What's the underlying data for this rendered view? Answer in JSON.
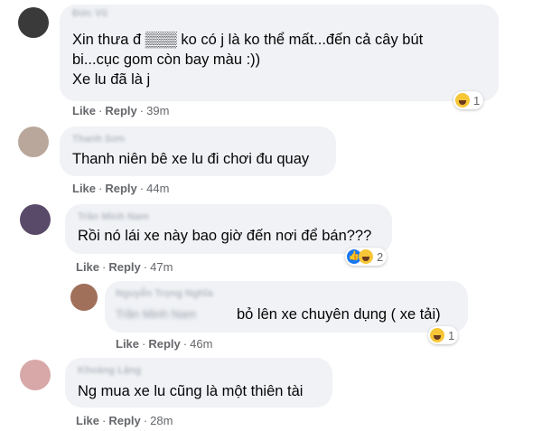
{
  "comments": [
    {
      "author": "Đức Vũ",
      "lines": [
        "Xin thưa đ ▒▒▒ ko có j là ko thể mất...đến cả cây bút",
        "bi...cục gom còn bay màu :))",
        "Xe lu đã là j"
      ],
      "like": "Like",
      "reply": "Reply",
      "time": "39m",
      "reaction_count": "1",
      "avatar_color": "#3a3a3a"
    },
    {
      "author": "Thanh Sơn",
      "lines": [
        "Thanh niên bê xe lu đi chơi đu quay"
      ],
      "like": "Like",
      "reply": "Reply",
      "time": "44m",
      "avatar_color": "#b9a79c"
    },
    {
      "author": "Trần Minh Nam",
      "lines": [
        "Rồi nó lái xe này bao giờ đến nơi để bán???"
      ],
      "like": "Like",
      "reply": "Reply",
      "time": "47m",
      "reaction_count": "2",
      "avatar_color": "#5a4a6a"
    },
    {
      "author": "Nguyễn Trọng Nghĩa",
      "mention": "Trần Minh Nam",
      "lines": [
        "bỏ lên xe chuyên dụng ( xe tải)"
      ],
      "like": "Like",
      "reply": "Reply",
      "time": "46m",
      "reaction_count": "1",
      "avatar_color": "#a0705a"
    },
    {
      "author": "Khoảng Lặng",
      "lines": [
        "Ng mua xe lu cũng là một thiên tài"
      ],
      "like": "Like",
      "reply": "Reply",
      "time": "28m",
      "avatar_color": "#d8a8a8"
    }
  ],
  "icons": {
    "haha": "haha-reaction-icon",
    "like": "like-reaction-icon"
  },
  "colors": {
    "bubble": "#f0f2f5",
    "like_blue": "#1877f2",
    "haha_yellow": "#f7c637",
    "meta_gray": "#65676b"
  }
}
